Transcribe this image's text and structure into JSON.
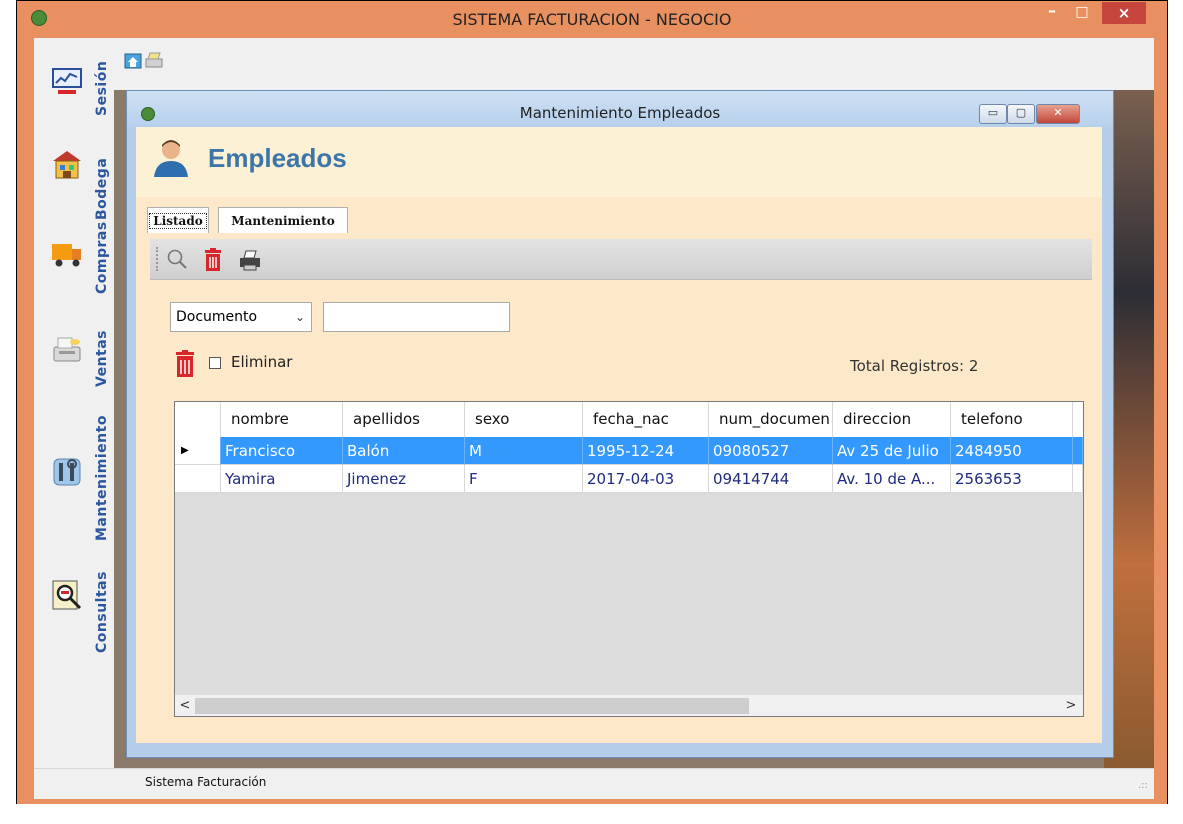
{
  "window": {
    "title": "SISTEMA FACTURACION - NEGOCIO",
    "minimize": "–",
    "maximize": "□",
    "close": "×"
  },
  "sidebar": {
    "items": [
      {
        "label": "Sesión",
        "icon": "chart-monitor-icon"
      },
      {
        "label": "Bodega",
        "icon": "warehouse-icon"
      },
      {
        "label": "Compras",
        "icon": "truck-icon"
      },
      {
        "label": "Ventas",
        "icon": "cash-register-icon"
      },
      {
        "label": "Mantenimiento",
        "icon": "tools-icon"
      },
      {
        "label": "Consultas",
        "icon": "magnifier-report-icon"
      }
    ]
  },
  "mdi_toolbar": {
    "icons": [
      "home-window-icon",
      "printer-icon"
    ]
  },
  "child_window": {
    "title": "Mantenimiento Empleados",
    "minimize": "▭",
    "maximize": "▢",
    "close": "✕"
  },
  "header": {
    "title": "Empleados",
    "icon": "user-icon"
  },
  "tabs": [
    {
      "label": "Listado",
      "active": true
    },
    {
      "label": "Mantenimiento",
      "active": false
    }
  ],
  "toolstrip": {
    "icons": [
      "search-icon",
      "trash-icon",
      "printer-icon"
    ]
  },
  "filter": {
    "field_selected": "Documento",
    "chevron": "⌄",
    "search_value": ""
  },
  "delete_row": {
    "checkbox_label": "Eliminar",
    "checked": false
  },
  "total_label": "Total Registros: 2",
  "grid": {
    "columns": [
      "nombre",
      "apellidos",
      "sexo",
      "fecha_nac",
      "num_documen",
      "direccion",
      "telefono"
    ],
    "rows": [
      {
        "selected": true,
        "pointer": "▶",
        "cells": [
          "Francisco",
          "Balón",
          "M",
          "1995-12-24",
          "09080527",
          "Av 25 de Julio",
          "2484950"
        ]
      },
      {
        "selected": false,
        "pointer": "",
        "cells": [
          "Yamira",
          "Jimenez",
          "F",
          "2017-04-03",
          "09414744",
          "Av. 10 de A...",
          "2563653"
        ]
      }
    ],
    "scroll_left": "<",
    "scroll_right": ">"
  },
  "statusbar": {
    "text": "Sistema Facturación",
    "grip": ".::"
  },
  "colors": {
    "window_frame": "#e89060",
    "selection": "#3399ff",
    "title_blue": "#3c75a8",
    "sidebar_text": "#2b57a0",
    "delete_red": "#d9262b"
  }
}
